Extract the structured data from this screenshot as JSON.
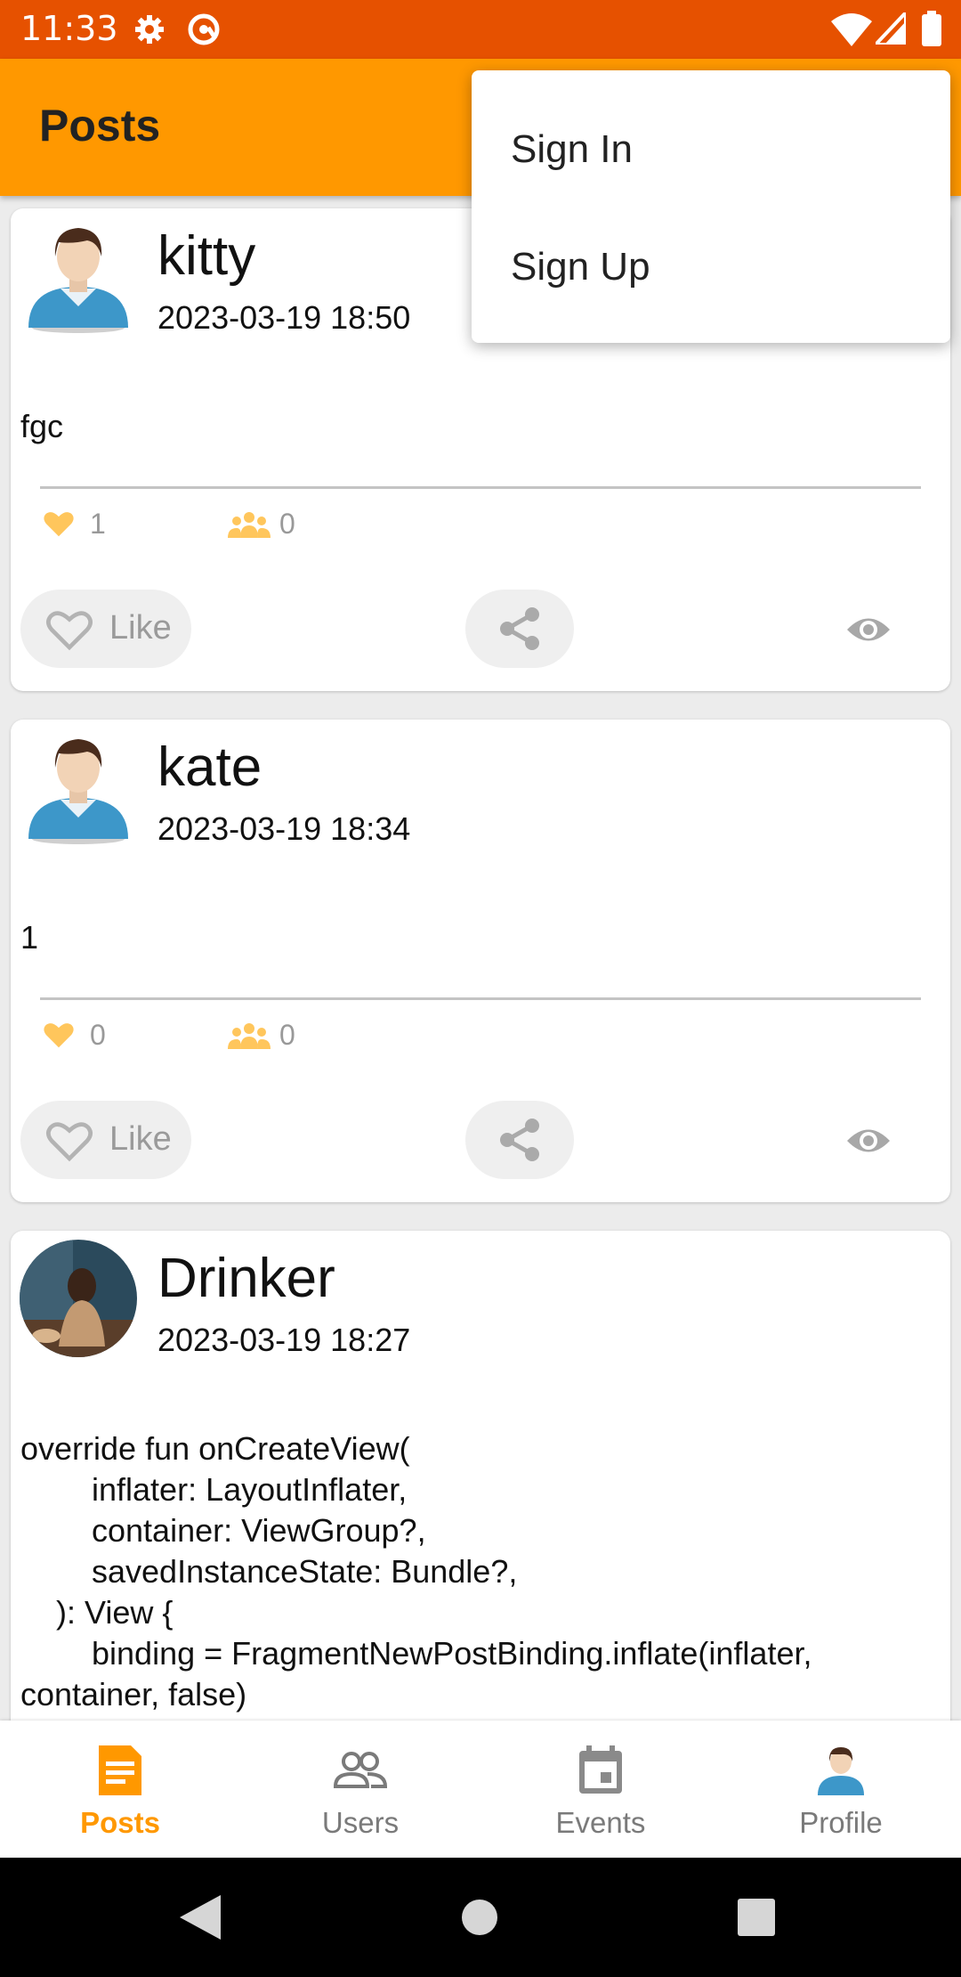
{
  "status_bar": {
    "time": "11:33",
    "color": "#e65100"
  },
  "app_bar": {
    "title": "Posts",
    "color": "#ff9800"
  },
  "menu": {
    "items": [
      "Sign In",
      "Sign Up"
    ]
  },
  "posts": [
    {
      "author": "kitty",
      "date": "2023-03-19 18:50",
      "body": "fgc",
      "likes": "1",
      "shares": "0",
      "like_label": "Like",
      "avatar": "default-male-avatar"
    },
    {
      "author": "kate",
      "date": "2023-03-19 18:34",
      "body": "1",
      "likes": "0",
      "shares": "0",
      "like_label": "Like",
      "avatar": "default-male-avatar"
    },
    {
      "author": "Drinker",
      "date": "2023-03-19 18:27",
      "body": "override fun onCreateView(\n        inflater: LayoutInflater,\n        container: ViewGroup?,\n        savedInstanceState: Bundle?,\n    ): View {\n        binding = FragmentNewPostBinding.inflate(inflater,\ncontainer, false)",
      "avatar": "photo-avatar"
    }
  ],
  "bottom_nav": {
    "active_color": "#ff9800",
    "items": [
      {
        "label": "Posts",
        "icon": "document-icon"
      },
      {
        "label": "Users",
        "icon": "users-icon"
      },
      {
        "label": "Events",
        "icon": "calendar-icon"
      },
      {
        "label": "Profile",
        "icon": "avatar-icon"
      }
    ]
  }
}
